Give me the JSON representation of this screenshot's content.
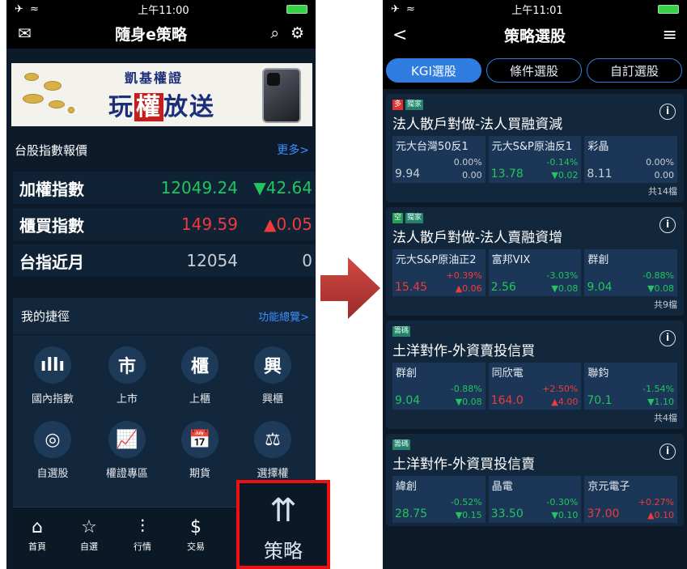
{
  "left": {
    "status": {
      "left": "✈ ≈",
      "time": "上午11:00"
    },
    "nav": {
      "title": "隨身e策略"
    },
    "banner": {
      "line1": "凱基權證",
      "line2_a": "玩",
      "line2_b": "權",
      "line2_c": "放送"
    },
    "index_section": {
      "title": "台股指數報價",
      "more": "更多>"
    },
    "indices": [
      {
        "name": "加權指數",
        "value": "12049.24",
        "change": "▼42.64",
        "dir": "down"
      },
      {
        "name": "櫃買指數",
        "value": "149.59",
        "change": "▲0.05",
        "dir": "up"
      },
      {
        "name": "台指近月",
        "value": "12054",
        "change": "0",
        "dir": "flat"
      }
    ],
    "shortcuts": {
      "title": "我的捷徑",
      "more": "功能總覽>",
      "items": [
        {
          "label": "國內指數",
          "icon": "bar-chart-icon",
          "glyph": "ıllı"
        },
        {
          "label": "上市",
          "icon": "listed-icon",
          "glyph": "市"
        },
        {
          "label": "上櫃",
          "icon": "otc-icon",
          "glyph": "櫃"
        },
        {
          "label": "興櫃",
          "icon": "emerging-icon",
          "glyph": "興"
        },
        {
          "label": "自選股",
          "icon": "target-icon",
          "glyph": "◎"
        },
        {
          "label": "權證專區",
          "icon": "warrant-chart-icon",
          "glyph": "📈"
        },
        {
          "label": "期貨",
          "icon": "futures-calendar-icon",
          "glyph": "📅"
        },
        {
          "label": "選擇權",
          "icon": "options-scale-icon",
          "glyph": "⚖"
        }
      ]
    },
    "tabbar": [
      {
        "label": "首頁",
        "icon": "home-icon",
        "glyph": "⌂"
      },
      {
        "label": "自選",
        "icon": "star-icon",
        "glyph": "☆"
      },
      {
        "label": "行情",
        "icon": "sliders-icon",
        "glyph": "⫶"
      },
      {
        "label": "交易",
        "icon": "dollar-icon",
        "glyph": "$"
      }
    ],
    "highlight": {
      "label": "策略",
      "icon": "strategy-arrows-icon"
    }
  },
  "right": {
    "status": {
      "left": "✈ ≈",
      "time": "上午11:01"
    },
    "nav": {
      "back": "<",
      "title": "策略選股",
      "menu": "≡"
    },
    "segments": [
      "KGI選股",
      "條件選股",
      "自訂選股"
    ],
    "cards": [
      {
        "tags": [
          {
            "text": "多",
            "kind": "red"
          },
          {
            "text": "獨家",
            "kind": "teal"
          }
        ],
        "title": "法人散戶對做-法人買融資減",
        "stocks": [
          {
            "name": "元大台灣50反1",
            "pct": "0.00%",
            "price": "9.94",
            "change": "0.00",
            "dir": "flat"
          },
          {
            "name": "元大S&P原油反1",
            "pct": "-0.14%",
            "price": "13.78",
            "change": "▼0.02",
            "dir": "down"
          },
          {
            "name": "彩晶",
            "pct": "0.00%",
            "price": "8.11",
            "change": "0.00",
            "dir": "flat"
          }
        ],
        "count": "共14檔"
      },
      {
        "tags": [
          {
            "text": "空",
            "kind": "green"
          },
          {
            "text": "獨家",
            "kind": "teal"
          }
        ],
        "title": "法人散戶對做-法人賣融資增",
        "stocks": [
          {
            "name": "元大S&P原油正2",
            "pct": "+0.39%",
            "price": "15.45",
            "change": "▲0.06",
            "dir": "up"
          },
          {
            "name": "富邦VIX",
            "pct": "-3.03%",
            "price": "2.56",
            "change": "▼0.08",
            "dir": "down"
          },
          {
            "name": "群創",
            "pct": "-0.88%",
            "price": "9.04",
            "change": "▼0.08",
            "dir": "down"
          }
        ],
        "count": "共9檔"
      },
      {
        "tags": [
          {
            "text": "籌碼",
            "kind": "teal"
          }
        ],
        "title": "土洋對作-外資賣投信買",
        "stocks": [
          {
            "name": "群創",
            "pct": "-0.88%",
            "price": "9.04",
            "change": "▼0.08",
            "dir": "down"
          },
          {
            "name": "同欣電",
            "pct": "+2.50%",
            "price": "164.0",
            "change": "▲4.00",
            "dir": "up"
          },
          {
            "name": "聯鈞",
            "pct": "-1.54%",
            "price": "70.1",
            "change": "▼1.10",
            "dir": "down"
          }
        ],
        "count": "共4檔"
      },
      {
        "tags": [
          {
            "text": "籌碼",
            "kind": "teal"
          }
        ],
        "title": "土洋對作-外資買投信賣",
        "stocks": [
          {
            "name": "緯創",
            "pct": "-0.52%",
            "price": "28.75",
            "change": "▼0.15",
            "dir": "down"
          },
          {
            "name": "晶電",
            "pct": "-0.30%",
            "price": "33.50",
            "change": "▼0.10",
            "dir": "down"
          },
          {
            "name": "京元電子",
            "pct": "+0.27%",
            "price": "37.00",
            "change": "▲0.10",
            "dir": "up"
          }
        ],
        "count": ""
      }
    ]
  }
}
